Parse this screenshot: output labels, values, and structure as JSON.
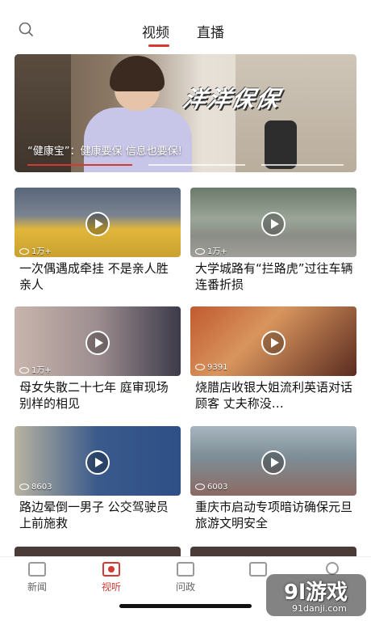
{
  "header": {
    "tabs": [
      {
        "label": "视频",
        "active": true
      },
      {
        "label": "直播",
        "active": false
      }
    ],
    "accent": "#d33a32"
  },
  "hero": {
    "logo_text": "洋洋保保",
    "caption": "“健康宝”：健康要保 信息也要保!"
  },
  "videos": [
    {
      "views": "1万+",
      "title": "一次偶遇成牵挂 不是亲人胜亲人"
    },
    {
      "views": "1万+",
      "title": "大学城路有“拦路虎”过往车辆连番折损"
    },
    {
      "views": "1万+",
      "title": "母女失散二十七年 庭审现场别样的相见"
    },
    {
      "views": "9391",
      "title": "烧腊店收银大姐流利英语对话顾客 丈夫称没…"
    },
    {
      "views": "8603",
      "title": "路边晕倒一男子 公交驾驶员上前施救"
    },
    {
      "views": "6003",
      "title": "重庆市启动专项暗访确保元旦旅游文明安全"
    }
  ],
  "bottom_nav": [
    {
      "label": "新闻",
      "icon": "news-icon",
      "active": false
    },
    {
      "label": "视听",
      "icon": "camera-icon",
      "active": true
    },
    {
      "label": "问政",
      "icon": "chat-icon",
      "active": false
    },
    {
      "label": "",
      "icon": "service-icon",
      "active": false
    },
    {
      "label": "",
      "icon": "profile-icon",
      "active": false
    }
  ],
  "watermark": {
    "main": "9l游戏",
    "url": "91danji.com"
  }
}
